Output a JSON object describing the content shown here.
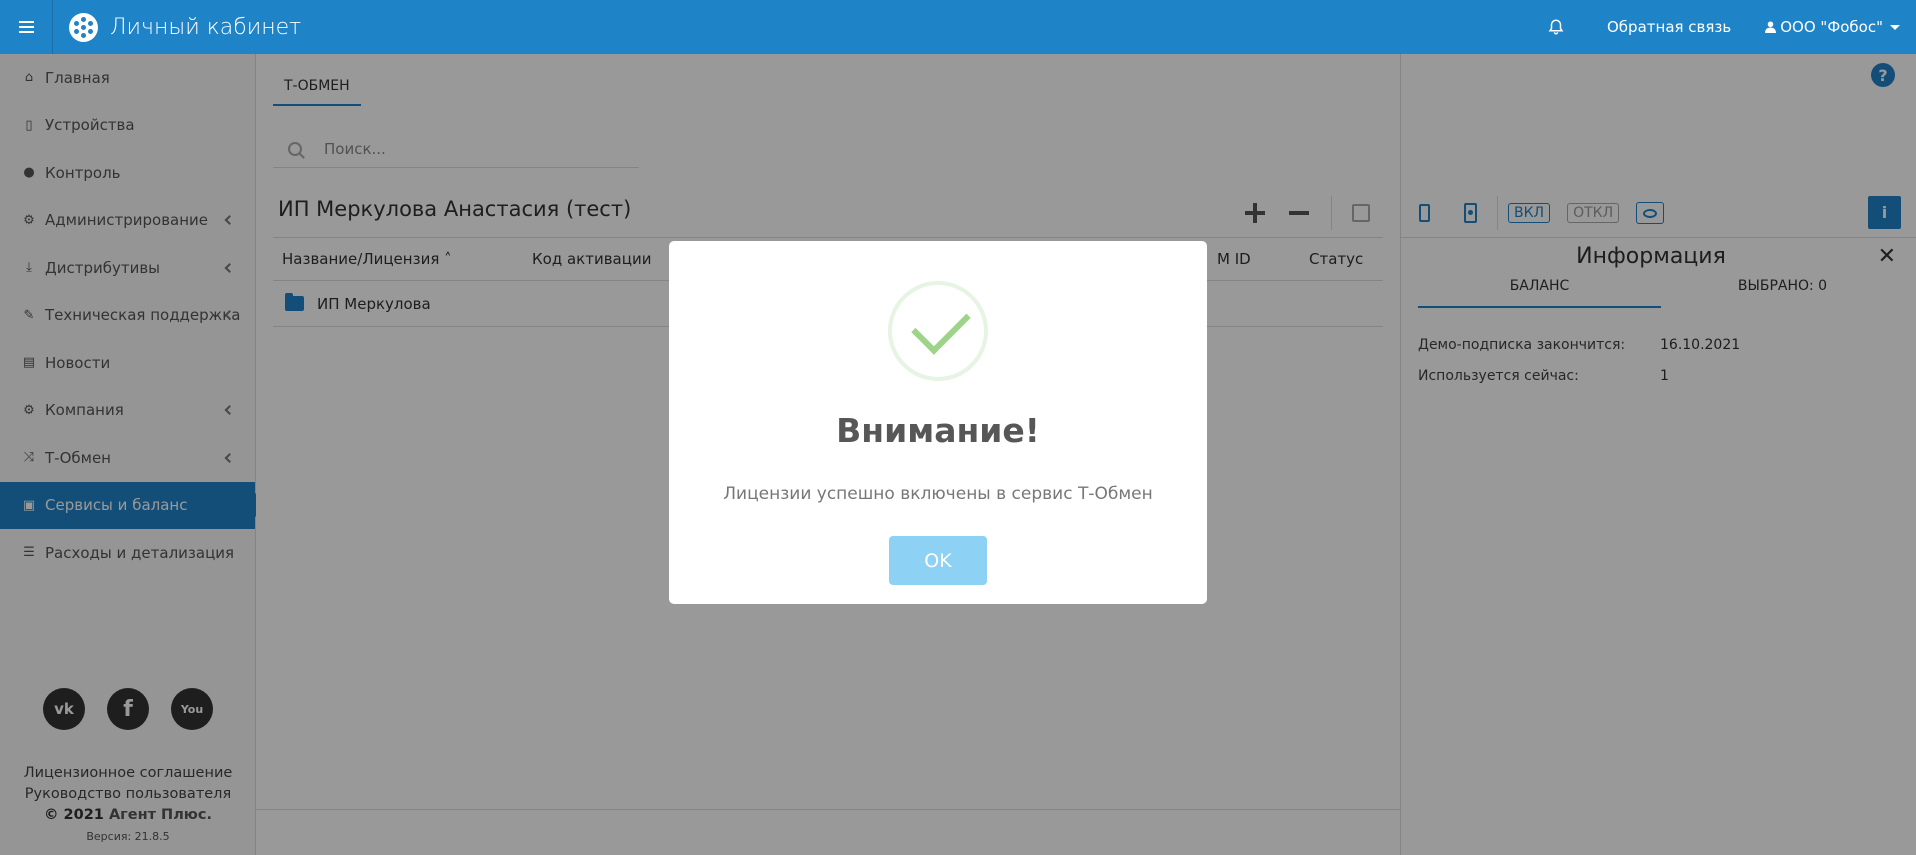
{
  "header": {
    "app_title": "Личный кабинет",
    "feedback": "Обратная связь",
    "company": "ООО \"Фобос\""
  },
  "sidebar": {
    "items": [
      {
        "label": "Главная",
        "icon": "home-icon",
        "chevron": false
      },
      {
        "label": "Устройства",
        "icon": "mobile-icon",
        "chevron": false
      },
      {
        "label": "Контроль",
        "icon": "globe-icon",
        "chevron": false
      },
      {
        "label": "Администрирование",
        "icon": "cogs-icon",
        "chevron": true
      },
      {
        "label": "Дистрибутивы",
        "icon": "download-icon",
        "chevron": true
      },
      {
        "label": "Техническая поддержка",
        "icon": "wrench-icon",
        "chevron": true
      },
      {
        "label": "Новости",
        "icon": "newspaper-icon",
        "chevron": false
      },
      {
        "label": "Компания",
        "icon": "gear-icon",
        "chevron": true
      },
      {
        "label": "Т-Обмен",
        "icon": "random-icon",
        "chevron": true
      },
      {
        "label": "Сервисы и баланс",
        "icon": "money-icon",
        "chevron": false,
        "active": true
      },
      {
        "label": "Расходы и детализация",
        "icon": "list-icon",
        "chevron": false
      }
    ],
    "social": [
      "vk-icon",
      "facebook-icon",
      "youtube-icon"
    ],
    "social_text": {
      "vk": "vk",
      "facebook": "f",
      "youtube": "You"
    },
    "footer": {
      "license": "Лицензионное соглашение",
      "guide": "Руководство пользователя",
      "copyright_year": "© 2021",
      "copyright_name": "Агент Плюс.",
      "version": "Версия: 21.8.5"
    }
  },
  "main": {
    "tab": "Т-ОБМЕН",
    "search_placeholder": "Поиск...",
    "company_title": "ИП Меркулова Анастасия (тест)",
    "columns": {
      "name": "Название/Лицензия",
      "code": "Код активации",
      "imei": "M ID",
      "status": "Статус"
    },
    "rows": [
      {
        "name": "ИП Меркулова"
      }
    ]
  },
  "right_panel": {
    "btn_on": "ВКЛ",
    "btn_off": "ОТКЛ",
    "info_title": "Информация",
    "tabs": [
      "БАЛАНС",
      "ВЫБРАНО: 0"
    ],
    "info": [
      {
        "key": "Демо-подписка закончится:",
        "value": "16.10.2021"
      },
      {
        "key": "Используется сейчас:",
        "value": "1"
      }
    ]
  },
  "modal": {
    "title": "Внимание!",
    "text": "Лицензии успешно включены в сервис Т-Обмен",
    "ok": "OK"
  },
  "colors": {
    "primary": "#1f83c7",
    "ok_button": "#8dd1f5",
    "check": "#9ed38a"
  }
}
